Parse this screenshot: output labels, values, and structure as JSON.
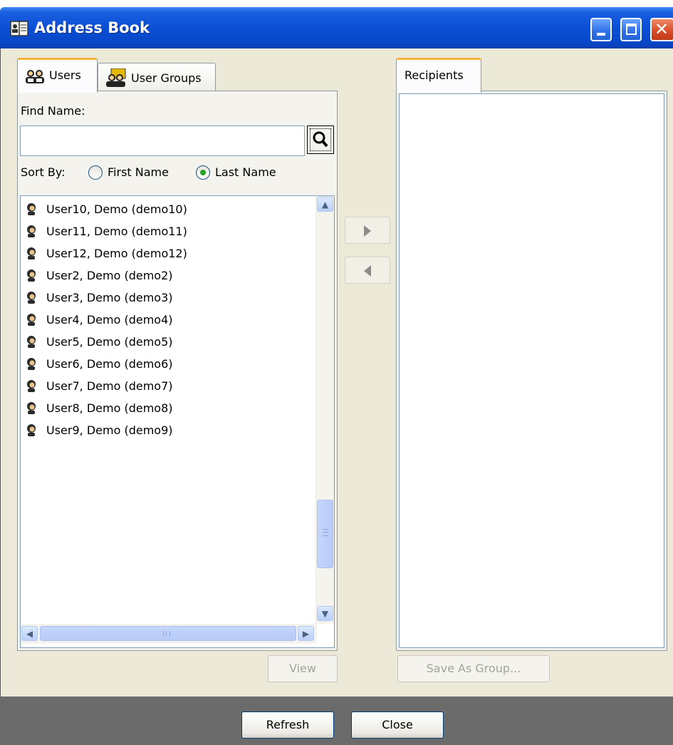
{
  "window": {
    "title": "Address Book",
    "icon": "address-book-icon"
  },
  "left_tabs": [
    {
      "label": "Users",
      "icon": "users-icon",
      "active": true
    },
    {
      "label": "User Groups",
      "icon": "user-groups-icon",
      "active": false
    }
  ],
  "right_tabs": [
    {
      "label": "Recipients",
      "active": true
    }
  ],
  "find": {
    "label": "Find Name:",
    "value": "",
    "placeholder": "",
    "button_icon": "search-icon"
  },
  "sort": {
    "label": "Sort By:",
    "options": [
      {
        "label": "First Name",
        "selected": false
      },
      {
        "label": "Last Name",
        "selected": true
      }
    ]
  },
  "users": [
    "User10, Demo (demo10)",
    "User11, Demo (demo11)",
    "User12, Demo (demo12)",
    "User2, Demo (demo2)",
    "User3, Demo (demo3)",
    "User4, Demo (demo4)",
    "User5, Demo (demo5)",
    "User6, Demo (demo6)",
    "User7, Demo (demo7)",
    "User8, Demo (demo8)",
    "User9, Demo (demo9)"
  ],
  "recipients": [],
  "buttons": {
    "view": "View",
    "save_as_group": "Save As Group...",
    "refresh": "Refresh",
    "close": "Close"
  },
  "colors": {
    "titlebar": "#0a4fd6",
    "panel": "#ece9d8",
    "footer": "#6b6b6b",
    "tab_highlight": "#f7b43a"
  }
}
